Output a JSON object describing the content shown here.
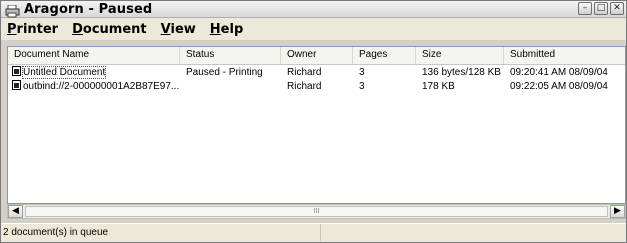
{
  "window": {
    "title": "Aragorn - Paused"
  },
  "menu": [
    {
      "accel": "P",
      "rest": "rinter"
    },
    {
      "accel": "D",
      "rest": "ocument"
    },
    {
      "accel": "V",
      "rest": "iew"
    },
    {
      "accel": "H",
      "rest": "elp"
    }
  ],
  "columns": [
    "Document Name",
    "Status",
    "Owner",
    "Pages",
    "Size",
    "Submitted"
  ],
  "rows": [
    {
      "name": "Untitled Document",
      "status": "Paused - Printing",
      "owner": "Richard",
      "pages": "3",
      "size": "136 bytes/128 KB",
      "submitted": "09:20:41 AM  08/09/04"
    },
    {
      "name": "outbind://2-000000001A2B87E97...",
      "status": "",
      "owner": "Richard",
      "pages": "3",
      "size": "178 KB",
      "submitted": "09:22:05 AM  08/09/04"
    }
  ],
  "scrollbar": {
    "thumb_grip": "III"
  },
  "status_bar": {
    "text": "2 document(s) in queue"
  }
}
